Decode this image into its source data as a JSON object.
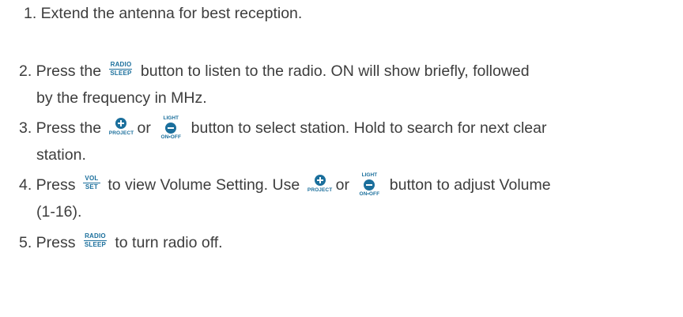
{
  "icons": {
    "radio_sleep": {
      "top": "RADIO",
      "bottom": "SLEEP"
    },
    "vol_set": {
      "top": "VOL",
      "bottom": "SET"
    },
    "plus_project": {
      "label": "PROJECT"
    },
    "minus_light": {
      "top": "LIGHT",
      "bottom": "ON•OFF"
    },
    "accent_color": "#1b6f9c"
  },
  "steps": [
    {
      "text": "1. Extend the antenna for best reception."
    },
    {
      "before": "2. Press the",
      "after": "button to listen to the radio. ON will show briefly, followed",
      "cont": "by the frequency in MHz."
    },
    {
      "before": "3. Press the",
      "mid": "or",
      "after": "button to select station. Hold to search for next clear",
      "cont": "station."
    },
    {
      "before": "4. Press",
      "mid1": "to view Volume Setting. Use",
      "mid2": "or",
      "after": "button to adjust Volume",
      "cont": "(1-16)."
    },
    {
      "before": "5. Press",
      "after": "to turn radio off."
    }
  ]
}
